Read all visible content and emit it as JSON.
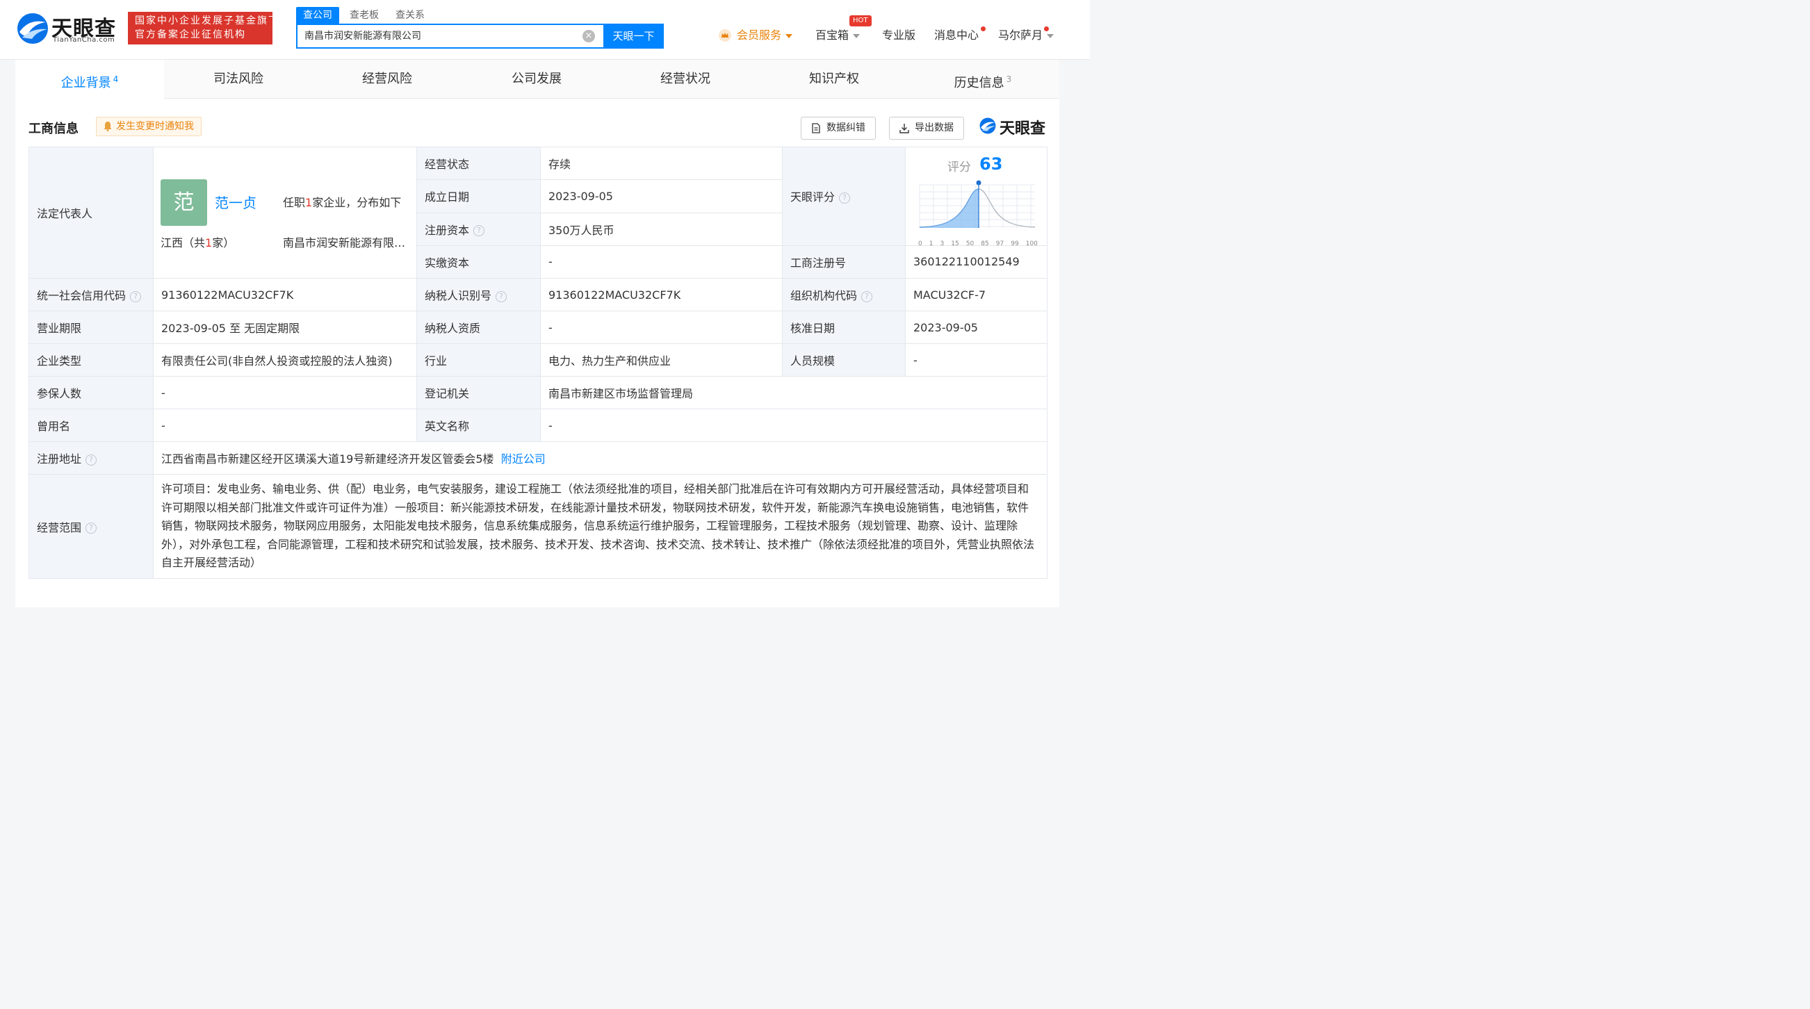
{
  "header": {
    "logo_text": "天眼查",
    "logo_sub": "TianYanCha.com",
    "badge_line1": "国家中小企业发展子基金旗下",
    "badge_line2": "官方备案企业征信机构",
    "search_tabs": [
      "查公司",
      "查老板",
      "查关系"
    ],
    "search_value": "南昌市润安新能源有限公司",
    "search_button": "天眼一下",
    "nav": {
      "vip": "会员服务",
      "baibaoxiang": "百宝箱",
      "hot": "HOT",
      "pro": "专业版",
      "messages": "消息中心",
      "user": "马尔萨月"
    }
  },
  "tabs": [
    {
      "label": "企业背景",
      "count": "4"
    },
    {
      "label": "司法风险",
      "count": ""
    },
    {
      "label": "经营风险",
      "count": ""
    },
    {
      "label": "公司发展",
      "count": ""
    },
    {
      "label": "经营状况",
      "count": ""
    },
    {
      "label": "知识产权",
      "count": ""
    },
    {
      "label": "历史信息",
      "count": "3"
    }
  ],
  "section": {
    "title": "工商信息",
    "notify": "发生变更时通知我",
    "btn_correct": "数据纠错",
    "btn_export": "导出数据",
    "brand": "天眼查"
  },
  "info": {
    "legal_rep_label": "法定代表人",
    "legal_rep_avatar": "范",
    "legal_rep_name": "范一贞",
    "legal_rep_roles_prefix": "任职",
    "legal_rep_roles_count": "1",
    "legal_rep_roles_suffix": "家企业，分布如下",
    "legal_rep_region_prefix": "江西（共",
    "legal_rep_region_count": "1",
    "legal_rep_region_suffix": "家）",
    "legal_rep_company": "南昌市润安新能源有限公司",
    "status_label": "经营状态",
    "status": "存续",
    "founded_label": "成立日期",
    "founded": "2023-09-05",
    "reg_capital_label": "注册资本",
    "reg_capital": "350万人民币",
    "paid_capital_label": "实缴资本",
    "paid_capital": "-",
    "score_label_row": "天眼评分",
    "score_text": "评分",
    "score": "63",
    "score_axis": [
      "0",
      "1",
      "3",
      "15",
      "50",
      "85",
      "97",
      "99",
      "100"
    ],
    "reg_no_label": "工商注册号",
    "reg_no": "360122110012549",
    "credit_code_label": "统一社会信用代码",
    "credit_code": "91360122MACU32CF7K",
    "taxpayer_id_label": "纳税人识别号",
    "taxpayer_id": "91360122MACU32CF7K",
    "org_code_label": "组织机构代码",
    "org_code": "MACU32CF-7",
    "term_label": "营业期限",
    "term": "2023-09-05 至 无固定期限",
    "taxpayer_qual_label": "纳税人资质",
    "taxpayer_qual": "-",
    "approval_date_label": "核准日期",
    "approval_date": "2023-09-05",
    "type_label": "企业类型",
    "type": "有限责任公司(非自然人投资或控股的法人独资)",
    "industry_label": "行业",
    "industry": "电力、热力生产和供应业",
    "staff_label": "人员规模",
    "staff": "-",
    "insured_label": "参保人数",
    "insured": "-",
    "authority_label": "登记机关",
    "authority": "南昌市新建区市场监督管理局",
    "former_name_label": "曾用名",
    "former_name": "-",
    "english_name_label": "英文名称",
    "english_name": "-",
    "address_label": "注册地址",
    "address": "江西省南昌市新建区经开区璜溪大道19号新建经济开发区管委会5楼",
    "nearby": "附近公司",
    "scope_label": "经营范围",
    "scope": "许可项目：发电业务、输电业务、供（配）电业务，电气安装服务，建设工程施工（依法须经批准的项目，经相关部门批准后在许可有效期内方可开展经营活动，具体经营项目和许可期限以相关部门批准文件或许可证件为准）一般项目：新兴能源技术研发，在线能源计量技术研发，物联网技术研发，软件开发，新能源汽车换电设施销售，电池销售，软件销售，物联网技术服务，物联网应用服务，太阳能发电技术服务，信息系统集成服务，信息系统运行维护服务，工程管理服务，工程技术服务（规划管理、勘察、设计、监理除外），对外承包工程，合同能源管理，工程和技术研究和试验发展，技术服务、技术开发、技术咨询、技术交流、技术转让、技术推广（除依法须经批准的项目外，凭营业执照依法自主开展经营活动）"
  },
  "colors": {
    "brand_blue": "#0084ff",
    "badge_red": "#d9352c",
    "vip_orange": "#e8830c",
    "avatar_green": "#7fbc9a"
  }
}
